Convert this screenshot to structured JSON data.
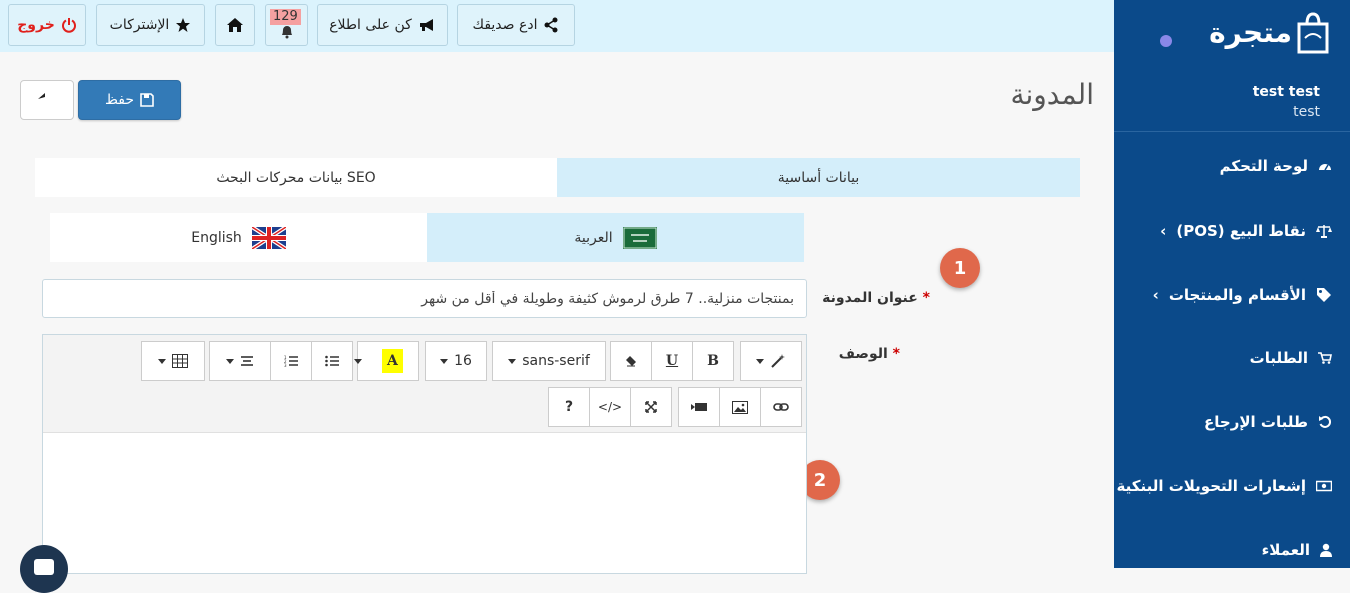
{
  "topbar": {
    "logout_label": "خروج",
    "subscriptions_label": "الإشتركات",
    "notifications_count": "129",
    "stay_informed_label": "كن على اطلاع",
    "invite_friend_label": "ادع صديقك"
  },
  "sidebar": {
    "brand": "متجرة",
    "user_name": "test test",
    "user_sub": "test",
    "items": [
      {
        "label": "لوحة التحكم",
        "icon": "dashboard-icon"
      },
      {
        "label": "نقاط البيع (POS)",
        "icon": "balance-scale-icon",
        "chevron": "‹"
      },
      {
        "label": "الأقسام والمنتجات",
        "icon": "tag-icon",
        "chevron": "‹"
      },
      {
        "label": "الطلبات",
        "icon": "cart-icon"
      },
      {
        "label": "طلبات الإرجاع",
        "icon": "undo-icon"
      },
      {
        "label": "إشعارات التحويلات البنكية",
        "icon": "money-icon"
      },
      {
        "label": "العملاء",
        "icon": "user-icon"
      }
    ]
  },
  "page": {
    "title": "المدونة",
    "save_label": "حفظ"
  },
  "tabs": {
    "basic": "بيانات أساسية",
    "seo": "بيانات محركات البحث SEO"
  },
  "lang_tabs": {
    "arabic": "العربية",
    "english": "English"
  },
  "form": {
    "title_label": "عنوان المدونة",
    "title_value": "بمنتجات منزلية.. 7 طرق لرموش كثيفة وطويلة في أقل من شهر",
    "description_label": "الوصف",
    "required_mark": "*"
  },
  "editor": {
    "font_name": "sans-serif",
    "font_size": "16",
    "bold": "B",
    "underline": "U",
    "highlight": "A",
    "help": "?",
    "code": "</>"
  },
  "markers": {
    "one": "1",
    "two": "2"
  },
  "colors": {
    "sidebar": "#0b4a8a",
    "topbar": "#dbf3fd",
    "primary": "#337ab7",
    "marker": "#e0684b",
    "logout": "#e0201c"
  }
}
